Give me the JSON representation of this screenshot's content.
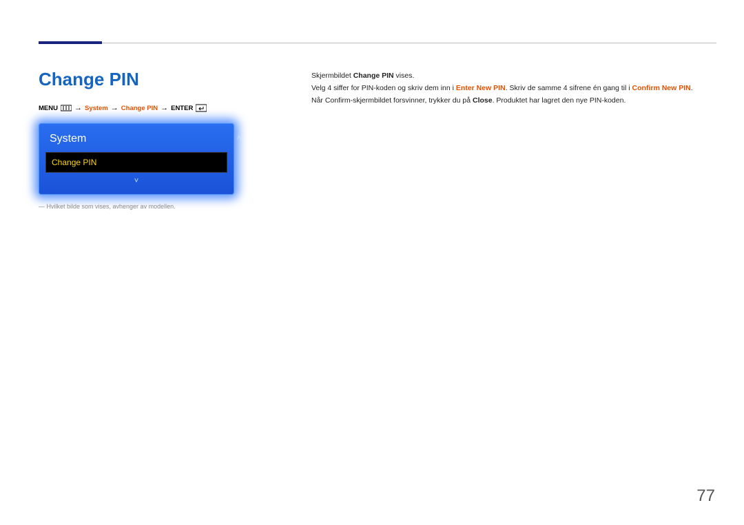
{
  "heading": "Change PIN",
  "breadcrumb": {
    "menu": "MENU",
    "system": "System",
    "change_pin": "Change PIN",
    "enter": "ENTER"
  },
  "panel": {
    "title": "System",
    "item": "Change PIN"
  },
  "footnote": "― Hvilket bilde som vises, avhenger av modellen.",
  "desc": {
    "l1a": "Skjermbildet ",
    "l1b": "Change PIN",
    "l1c": " vises.",
    "l2a": "Velg 4 siffer for PIN-koden og skriv dem inn i ",
    "l2b": "Enter New PIN",
    "l2c": ". Skriv de samme 4 sifrene én gang til i ",
    "l2d": "Confirm New PIN",
    "l2e": ".",
    "l3a": "Når Confirm-skjermbildet forsvinner, trykker du på ",
    "l3b": "Close",
    "l3c": ". Produktet har lagret den nye PIN-koden."
  },
  "page_number": "77"
}
